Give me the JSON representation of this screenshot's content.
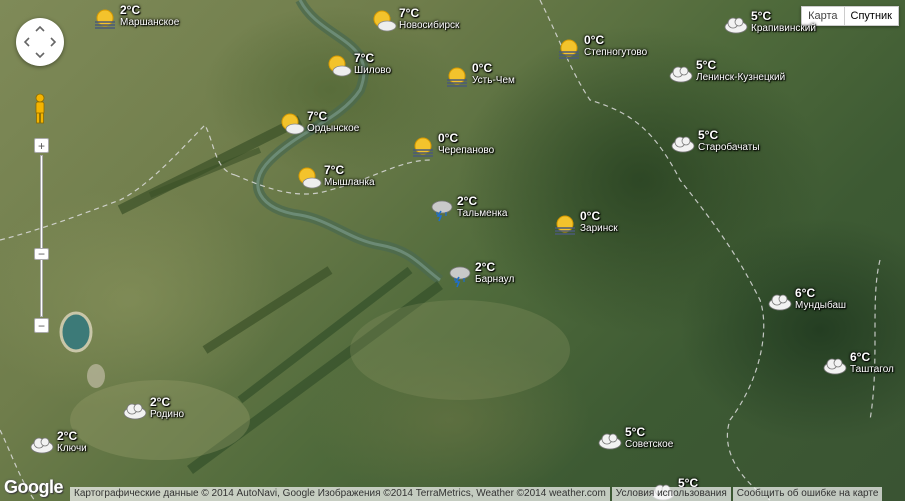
{
  "map_type": {
    "map": "Карта",
    "satellite": "Спутник",
    "active": "satellite"
  },
  "weather": [
    {
      "temp": "2°C",
      "city": "Маршанское",
      "icon": "sun-rain-icon"
    },
    {
      "temp": "7°C",
      "city": "Новосибирск",
      "icon": "partly-cloudy-icon"
    },
    {
      "temp": "0°C",
      "city": "Степногутово",
      "icon": "sun-rain-icon"
    },
    {
      "temp": "5°C",
      "city": "Крапивинский",
      "icon": "cloud-icon"
    },
    {
      "temp": "7°C",
      "city": "Шилово",
      "icon": "partly-cloudy-icon"
    },
    {
      "temp": "0°C",
      "city": "Усть-Чем",
      "icon": "sun-rain-icon"
    },
    {
      "temp": "5°C",
      "city": "Ленинск-Кузнецкий",
      "icon": "cloud-icon"
    },
    {
      "temp": "7°C",
      "city": "Ордынское",
      "icon": "partly-cloudy-icon"
    },
    {
      "temp": "0°C",
      "city": "Черепаново",
      "icon": "sun-rain-icon"
    },
    {
      "temp": "5°C",
      "city": "Старобачаты",
      "icon": "cloud-icon"
    },
    {
      "temp": "7°C",
      "city": "Мышланка",
      "icon": "partly-cloudy-icon"
    },
    {
      "temp": "2°C",
      "city": "Тальменка",
      "icon": "thunderstorm-icon"
    },
    {
      "temp": "0°C",
      "city": "Заринск",
      "icon": "sun-rain-icon"
    },
    {
      "temp": "2°C",
      "city": "Барнаул",
      "icon": "thunderstorm-icon"
    },
    {
      "temp": "6°C",
      "city": "Мундыбаш",
      "icon": "cloud-icon"
    },
    {
      "temp": "6°C",
      "city": "Таштагол",
      "icon": "cloud-icon"
    },
    {
      "temp": "2°C",
      "city": "Родино",
      "icon": "cloud-icon"
    },
    {
      "temp": "2°C",
      "city": "Ключи",
      "icon": "cloud-icon"
    },
    {
      "temp": "5°C",
      "city": "Советское",
      "icon": "cloud-icon"
    },
    {
      "temp": "5°C",
      "city": "",
      "icon": "cloud-icon"
    }
  ],
  "controls": {
    "zoom_in": "+",
    "zoom_out": "−",
    "pan": "pan-control",
    "pegman": "pegman-icon"
  },
  "footer": {
    "logo": "Google",
    "attribution": "Картографические данные © 2014 AutoNavi, Google Изображения ©2014 TerraMetrics, Weather ©2014 weather.com",
    "terms": "Условия использования",
    "report": "Сообщить об ошибке на карте"
  }
}
